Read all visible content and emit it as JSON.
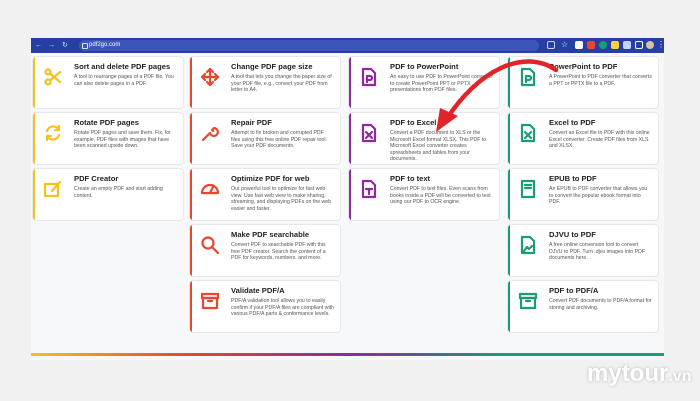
{
  "browser": {
    "url": "pdf2go.com",
    "nav_back": "←",
    "nav_forward": "→",
    "nav_reload": "↻",
    "toolbar_icons": [
      "share-icon",
      "star-icon",
      "extension-icon",
      "extension-icon",
      "extension-icon",
      "extension-icon",
      "puzzle-icon",
      "sidebar-icon",
      "profile-icon",
      "menu-icon"
    ]
  },
  "tools": [
    {
      "title": "Sort and delete PDF pages",
      "desc": "A tool to rearrange pages of a PDF file. You can also delete pages in a PDF.",
      "icon": "scissors-icon",
      "color": "#f4c21b"
    },
    {
      "title": "Rotate PDF pages",
      "desc": "Rotate PDF pages and save them. Fix, for example, PDF files with images that have been scanned upside down.",
      "icon": "rotate-icon",
      "color": "#f4c21b"
    },
    {
      "title": "PDF Creator",
      "desc": "Create an empty PDF and start adding content.",
      "icon": "pdf-create-icon",
      "color": "#f4c21b"
    },
    {
      "title": "Change PDF page size",
      "desc": "A tool that lets you change the paper size of your PDF file, e.g., convert your PDF from letter to A4.",
      "icon": "resize-arrows-icon",
      "color": "#e9452f"
    },
    {
      "title": "Repair PDF",
      "desc": "Attempt to fix broken and corrupted PDF files using this free online PDF repair tool. Save your PDF documents.",
      "icon": "wrench-icon",
      "color": "#e9452f"
    },
    {
      "title": "Optimize PDF for web",
      "desc": "Our powerful tool to optimize for fast web view. Use fast web view to make sharing, streaming, and displaying PDFs on the web easier and faster.",
      "icon": "speedometer-icon",
      "color": "#e9452f"
    },
    {
      "title": "Make PDF searchable",
      "desc": "Convert PDF to searchable PDF with this free PDF creator. Search the content of a PDF for keywords, numbers, and more.",
      "icon": "search-icon",
      "color": "#e9452f"
    },
    {
      "title": "Validate PDF/A",
      "desc": "PDF/A validation tool allows you to easily confirm if your PDF/A files are compliant with various PDF/A parts & conformance levels.",
      "icon": "archive-icon",
      "color": "#e9452f"
    },
    {
      "title": "PDF to PowerPoint",
      "desc": "An easy to use PDF to PowerPoint converter to create PowerPoint PPT or PPTX presentations from PDF files.",
      "icon": "ppt-file-icon",
      "color": "#8e2a9c"
    },
    {
      "title": "PDF to Excel",
      "desc": "Convert a PDF document to XLS or the Microsoft Excel format XLSX. This PDF to Microsoft Excel converter creates spreadsheets and tables from your documents.",
      "icon": "excel-file-icon",
      "color": "#8e2a9c"
    },
    {
      "title": "PDF to text",
      "desc": "Convert PDF to text files. Even scans from books inside a PDF will be converted to text using our PDF to OCR engine.",
      "icon": "text-file-icon",
      "color": "#8e2a9c"
    },
    {
      "title": "PowerPoint to PDF",
      "desc": "A PowerPoint to PDF converter that converts a PPT or PPTX file to a PDF.",
      "icon": "ppt-file-icon",
      "color": "#1a9c79"
    },
    {
      "title": "Excel to PDF",
      "desc": "Convert an Excel file to PDF with this online Excel converter. Create PDF files from XLS and XLSX.",
      "icon": "excel-file-icon",
      "color": "#1a9c79"
    },
    {
      "title": "EPUB to PDF",
      "desc": "An EPUB to PDF converter that allows you to convert the popular ebook format into PDF.",
      "icon": "book-icon",
      "color": "#1a9c79"
    },
    {
      "title": "DJVU to PDF",
      "desc": "A free online conversion tool to convert DJVU to PDF. Turn .djvu images into PDF documents here.",
      "icon": "image-file-icon",
      "color": "#1a9c79"
    },
    {
      "title": "PDF to PDF/A",
      "desc": "Convert PDF documents to PDF/A format for storing and archiving.",
      "icon": "archive-icon",
      "color": "#1a9c79"
    }
  ],
  "watermark": {
    "brand": "mytour",
    "tld": ".vn"
  },
  "colors": {
    "yellow": "#f4c21b",
    "red": "#e9452f",
    "purple": "#8e2a9c",
    "green": "#1a9c79",
    "arrow": "#e0242a",
    "browser": "#253fa2"
  }
}
